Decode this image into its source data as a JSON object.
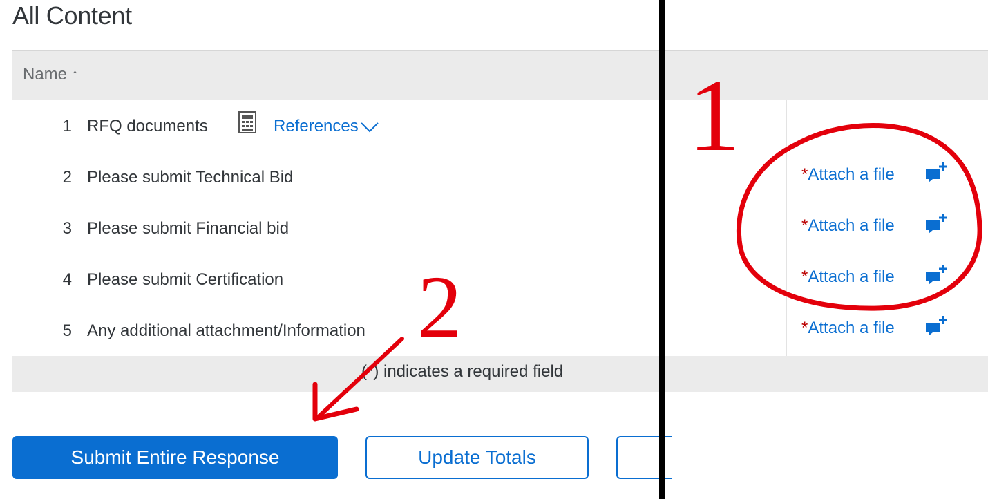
{
  "page": {
    "title": "All Content"
  },
  "table": {
    "header": {
      "name_label": "Name",
      "sort_glyph": "↑"
    },
    "rows": [
      {
        "num": "1",
        "name": "RFQ documents",
        "references_label": "References"
      },
      {
        "num": "2",
        "name": "Please submit Technical Bid",
        "required_mark": "*",
        "attach_label": "Attach a file"
      },
      {
        "num": "3",
        "name": "Please submit Financial bid",
        "required_mark": "*",
        "attach_label": "Attach a file"
      },
      {
        "num": "4",
        "name": "Please submit Certification",
        "required_mark": "*",
        "attach_label": "Attach a file"
      },
      {
        "num": "5",
        "name": "Any additional attachment/Information",
        "required_mark": "*",
        "attach_label": "Attach a file"
      }
    ],
    "footer_note": "(*) indicates a required field"
  },
  "buttons": {
    "submit": "Submit Entire Response",
    "update": "Update Totals"
  },
  "annotations": {
    "marker_1": "1",
    "marker_2": "2",
    "color": "#e3000b"
  },
  "colors": {
    "accent": "#0a6ed1",
    "required": "#bb0000",
    "header_bg": "#ebebeb"
  },
  "icons": {
    "sort": "arrow-up-icon",
    "document": "document-icon",
    "dropdown": "chevron-down-icon",
    "comment": "add-comment-icon"
  }
}
